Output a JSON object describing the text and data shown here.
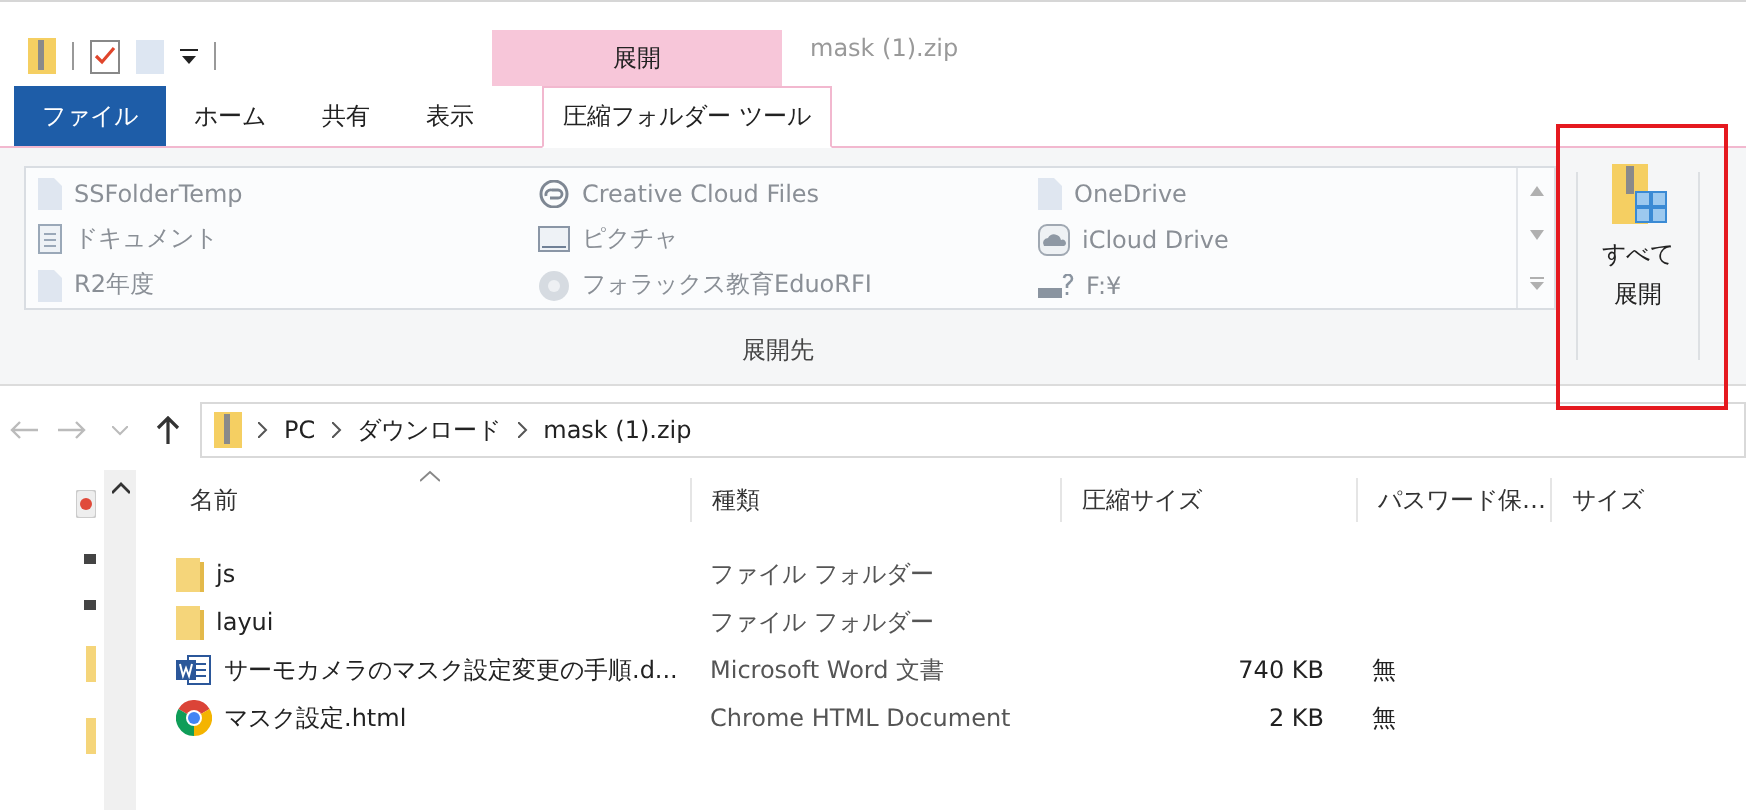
{
  "title_bar": {
    "context_tab": "展開",
    "title": "mask (1).zip"
  },
  "ribbon_tabs": [
    {
      "label": "ファイル",
      "kind": "file",
      "selected": false
    },
    {
      "label": "ホーム",
      "kind": "tab",
      "selected": false
    },
    {
      "label": "共有",
      "kind": "tab",
      "selected": false
    },
    {
      "label": "表示",
      "kind": "tab",
      "selected": false
    },
    {
      "label": "圧縮フォルダー ツール",
      "kind": "tab",
      "selected": true
    }
  ],
  "ribbon": {
    "destinations": [
      {
        "label": "SSFolderTemp",
        "kind": "folder"
      },
      {
        "label": "Creative Cloud Files",
        "kind": "creative-cloud"
      },
      {
        "label": "OneDrive",
        "kind": "folder"
      },
      {
        "label": "ドキュメント",
        "kind": "documents"
      },
      {
        "label": "ピクチャ",
        "kind": "pictures"
      },
      {
        "label": "iCloud Drive",
        "kind": "cloud"
      },
      {
        "label": "R2年度",
        "kind": "folder"
      },
      {
        "label": "フォラックス教育EduoRFI",
        "kind": "globe"
      },
      {
        "label": "F:¥",
        "kind": "drive"
      }
    ],
    "group_label": "展開先",
    "extract_all": [
      "すべて",
      "展開"
    ]
  },
  "address": {
    "path": [
      "PC",
      "ダウンロード",
      "mask (1).zip"
    ]
  },
  "columns": [
    "名前",
    "種類",
    "圧縮サイズ",
    "パスワード保…",
    "サイズ"
  ],
  "rows": [
    {
      "kind": "folder",
      "name": "js",
      "type": "ファイル フォルダー"
    },
    {
      "kind": "folder",
      "name": "layui",
      "type": "ファイル フォルダー"
    },
    {
      "kind": "word",
      "name": "サーモカメラのマスク設定変更の手順.d...",
      "type": "Microsoft Word 文書",
      "compressed_size": "740 KB",
      "password": "無"
    },
    {
      "kind": "chrome",
      "name": "マスク設定.html",
      "type": "Chrome HTML Document",
      "compressed_size": "2 KB",
      "password": "無"
    }
  ]
}
